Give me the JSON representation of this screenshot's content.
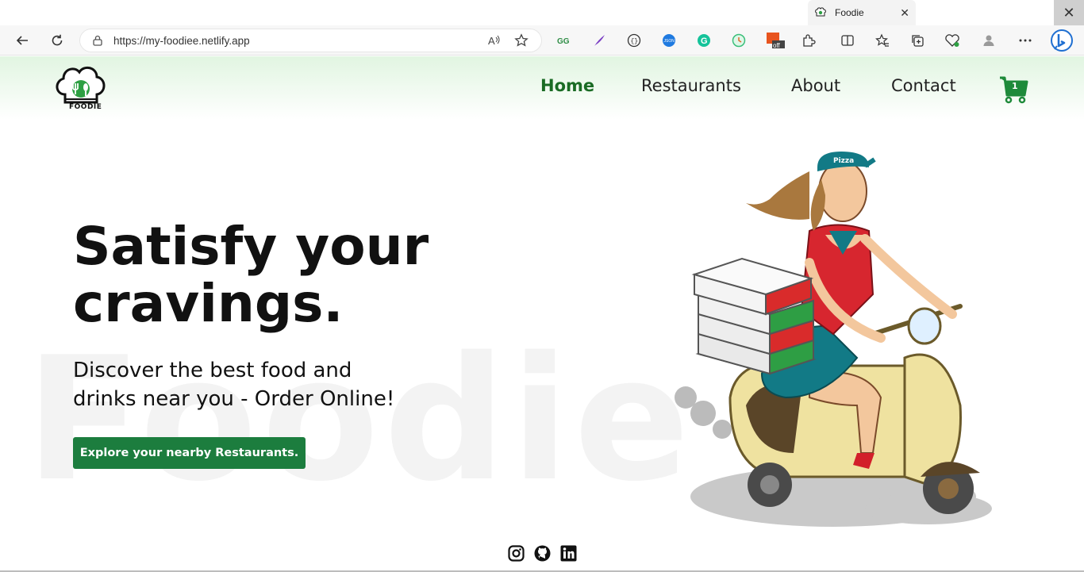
{
  "browser": {
    "tab_title": "Foodie",
    "tab_close": "✕",
    "window_close": "✕",
    "url": "https://my-foodiee.netlify.app",
    "extension_badge": "off",
    "icons": [
      "back-icon",
      "refresh-icon",
      "lock-icon",
      "read-aloud-icon",
      "favorite-star-icon",
      "extensions-icon",
      "split-screen-icon",
      "favorites-icon",
      "collections-icon",
      "performance-icon",
      "profile-icon",
      "more-icon",
      "bing-icon"
    ]
  },
  "nav": {
    "logo_text": "FOODIE",
    "links": [
      "Home",
      "Restaurants",
      "About",
      "Contact"
    ],
    "cart_count": "1"
  },
  "hero": {
    "watermark": "Foodie",
    "headline_line1": "Satisfy your",
    "headline_line2": "cravings.",
    "sub_line1": "Discover the best food and",
    "sub_line2": "drinks near you - Order Online!",
    "cta": "Explore your nearby Restaurants.",
    "art_label": "Pizza"
  },
  "colors": {
    "brand_green": "#1c7d3e",
    "nav_active": "#1a6b24",
    "cart_green": "#1e8a3a"
  },
  "footer": {
    "social_icons": [
      "instagram-icon",
      "github-icon",
      "linkedin-icon"
    ]
  }
}
